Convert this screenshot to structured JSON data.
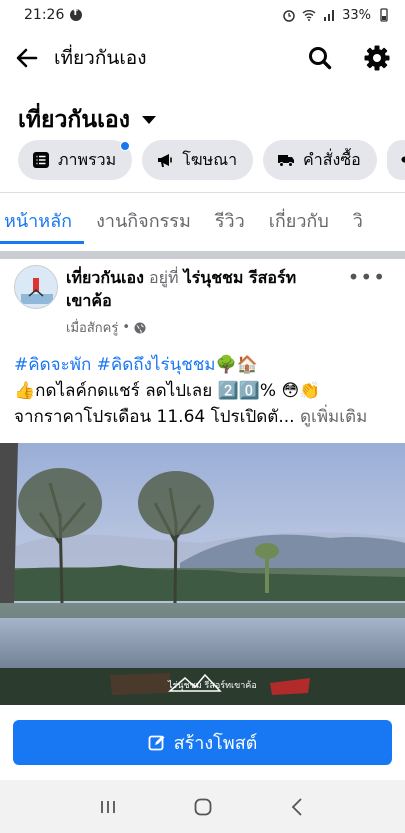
{
  "status_bar": {
    "time": "21:26",
    "battery": "33%"
  },
  "nav": {
    "title": "เที่ยวกันเอง"
  },
  "page": {
    "name": "เที่ยวกันเอง"
  },
  "chips": [
    {
      "label": "ภาพรวม",
      "icon": "list-icon"
    },
    {
      "label": "โฆษณา",
      "icon": "megaphone-icon"
    },
    {
      "label": "คำสั่งซื้อ",
      "icon": "truck-icon"
    }
  ],
  "tabs": [
    "หน้าหลัก",
    "งานกิจกรรม",
    "รีวิว",
    "เกี่ยวกับ",
    "วิ"
  ],
  "post": {
    "author": "เที่ยวกันเอง",
    "at_text": "อยู่ที่",
    "place_line1": "ไร่นุชชม รีสอร์ท",
    "place_line2": "เขาค้อ",
    "time": "เมื่อสักครู่",
    "hashtags": "#คิดจะพัก #คิดถึงไร่นุชชม",
    "line2": "👍กดไลค์กดแชร์ ลดไปเลย 2️⃣0️⃣% 😳👏",
    "line3": "จากราคาโปรเดือน 11.64 โปรเปิดตั...",
    "see_more": "ดูเพิ่มเติม",
    "watermark": "ไร่นุชชม รีสอร์ทเขาค้อ"
  },
  "create_post_label": "สร้างโพสต์",
  "colors": {
    "accent": "#1877f2",
    "chip_bg": "#e4e6eb"
  }
}
